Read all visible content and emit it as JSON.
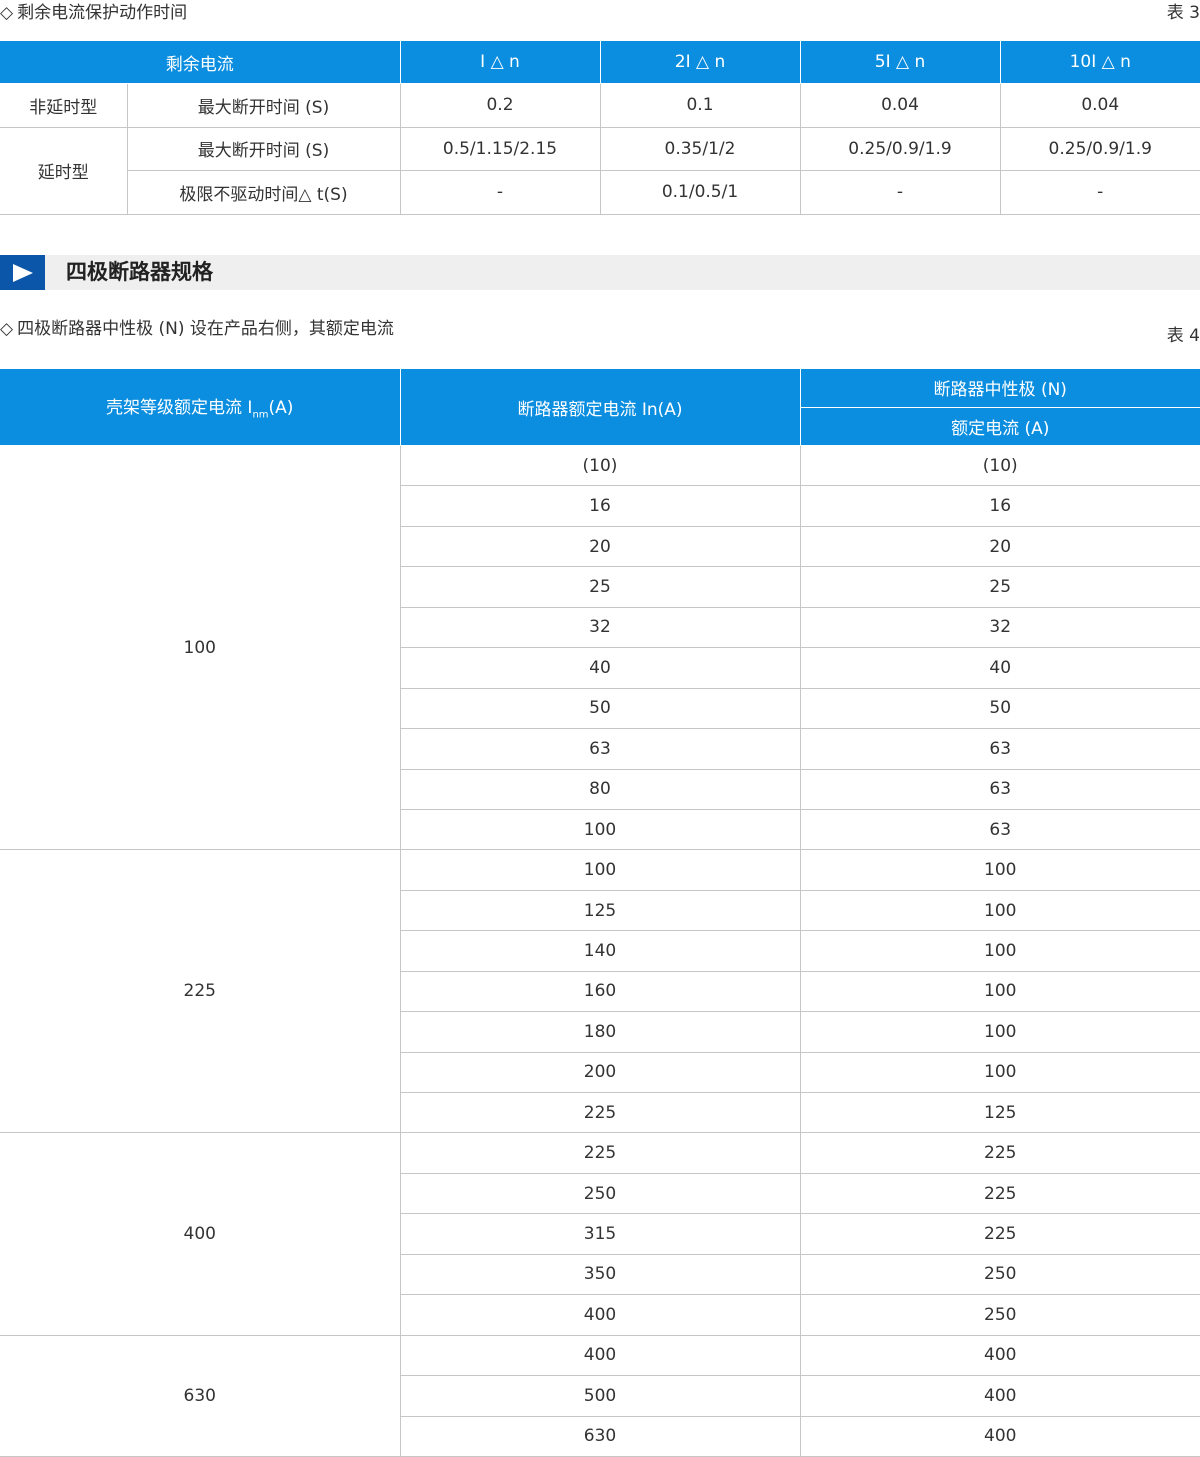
{
  "table3": {
    "caption": "剩余电流保护动作时间",
    "table_no": "表 3",
    "header": [
      "剩余电流",
      "I △ n",
      "2I △ n",
      "5I △ n",
      "10I △ n"
    ],
    "rows": [
      {
        "group": "非延时型",
        "label": "最大断开时间 (S)",
        "values": [
          "0.2",
          "0.1",
          "0.04",
          "0.04"
        ]
      },
      {
        "group": "延时型",
        "label": "最大断开时间 (S)",
        "values": [
          "0.5/1.15/2.15",
          "0.35/1/2",
          "0.25/0.9/1.9",
          "0.25/0.9/1.9"
        ]
      },
      {
        "label": "极限不驱动时间△ t(S)",
        "values": [
          "-",
          "0.1/0.5/1",
          "-",
          "-"
        ]
      }
    ]
  },
  "section": {
    "title": "四极断路器规格"
  },
  "table4": {
    "caption": "四极断路器中性极 (N) 设在产品右侧，其额定电流",
    "table_no": "表 4",
    "header": {
      "col1_main": "壳架等级额定电流 I",
      "col1_sub": "nm",
      "col1_tail": "(A)",
      "col2": "断路器额定电流 In(A)",
      "col3_top": "断路器中性极 (N)",
      "col3_bottom": "额定电流 (A)"
    },
    "groups": [
      {
        "frame": "100",
        "rows": [
          [
            "(10)",
            "(10)"
          ],
          [
            "16",
            "16"
          ],
          [
            "20",
            "20"
          ],
          [
            "25",
            "25"
          ],
          [
            "32",
            "32"
          ],
          [
            "40",
            "40"
          ],
          [
            "50",
            "50"
          ],
          [
            "63",
            "63"
          ],
          [
            "80",
            "63"
          ],
          [
            "100",
            "63"
          ]
        ]
      },
      {
        "frame": "225",
        "rows": [
          [
            "100",
            "100"
          ],
          [
            "125",
            "100"
          ],
          [
            "140",
            "100"
          ],
          [
            "160",
            "100"
          ],
          [
            "180",
            "100"
          ],
          [
            "200",
            "100"
          ],
          [
            "225",
            "125"
          ]
        ]
      },
      {
        "frame": "400",
        "rows": [
          [
            "225",
            "225"
          ],
          [
            "250",
            "225"
          ],
          [
            "315",
            "225"
          ],
          [
            "350",
            "250"
          ],
          [
            "400",
            "250"
          ]
        ]
      },
      {
        "frame": "630",
        "rows": [
          [
            "400",
            "400"
          ],
          [
            "500",
            "400"
          ],
          [
            "630",
            "400"
          ]
        ]
      }
    ]
  }
}
